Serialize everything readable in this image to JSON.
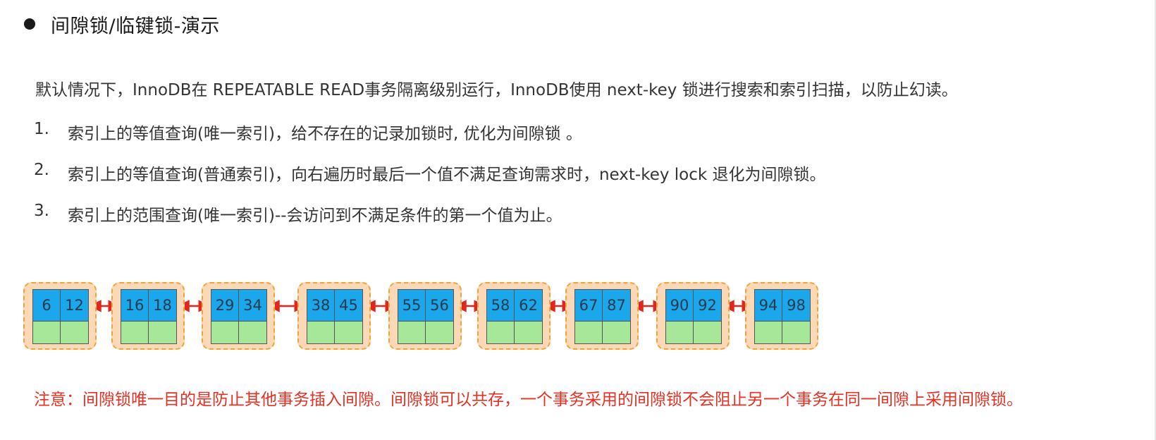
{
  "heading": {
    "title": "间隙锁/临键锁-演示"
  },
  "intro": "默认情况下，InnoDB在 REPEATABLE READ事务隔离级别运行，InnoDB使用 next-key 锁进行搜索和索引扫描，以防止幻读。",
  "rules": [
    {
      "num": "1.",
      "text": "索引上的等值查询(唯一索引)，给不存在的记录加锁时, 优化为间隙锁 。"
    },
    {
      "num": "2.",
      "text": "索引上的等值查询(普通索引)，向右遍历时最后一个值不满足查询需求时，next-key lock 退化为间隙锁。"
    },
    {
      "num": "3.",
      "text": "索引上的范围查询(唯一索引)--会访问到不满足条件的第一个值为止。"
    }
  ],
  "nodes": [
    {
      "keys": [
        "6",
        "12"
      ]
    },
    {
      "keys": [
        "16",
        "18"
      ]
    },
    {
      "keys": [
        "29",
        "34"
      ]
    },
    {
      "keys": [
        "38",
        "45"
      ]
    },
    {
      "keys": [
        "55",
        "56"
      ]
    },
    {
      "keys": [
        "58",
        "62"
      ]
    },
    {
      "keys": [
        "67",
        "87"
      ]
    },
    {
      "keys": [
        "90",
        "92"
      ]
    },
    {
      "keys": [
        "94",
        "98"
      ]
    }
  ],
  "note": "注意：间隙锁唯一目的是防止其他事务插入间隙。间隙锁可以共存，一个事务采用的间隙锁不会阻止另一个事务在同一间隙上采用间隙锁。",
  "colors": {
    "node_bg": "#fbd9b6",
    "node_border": "#f1a33a",
    "key_cell": "#1aa7ec",
    "value_cell": "#a6e79a",
    "arrow": "#e3261c",
    "note_text": "#e53022"
  }
}
